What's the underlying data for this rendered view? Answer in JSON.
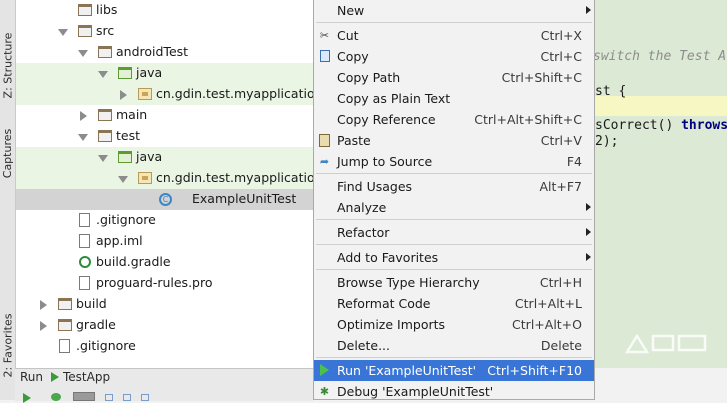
{
  "left_strip": {
    "structure_tab": "Z: Structure",
    "captures_tab": "Captures",
    "favorites_tab": "2: Favorites"
  },
  "tree": {
    "items": [
      {
        "label": "libs"
      },
      {
        "label": "src"
      },
      {
        "label": "androidTest"
      },
      {
        "label": "java"
      },
      {
        "label": "cn.gdin.test.myapplication"
      },
      {
        "label": "main"
      },
      {
        "label": "test"
      },
      {
        "label": "java"
      },
      {
        "label": "cn.gdin.test.myapplication"
      },
      {
        "label": "ExampleUnitTest"
      },
      {
        "label": ".gitignore"
      },
      {
        "label": "app.iml"
      },
      {
        "label": "build.gradle"
      },
      {
        "label": "proguard-rules.pro"
      },
      {
        "label": "build"
      },
      {
        "label": "gradle"
      },
      {
        "label": ".gitignore"
      }
    ]
  },
  "code": {
    "comment": "switch the Test A",
    "line1": "st {",
    "line2a": "sCorrect() ",
    "line2b": "throws",
    "line3": "2);"
  },
  "menu": {
    "items": [
      {
        "label": "New",
        "shortcut": ""
      },
      {
        "label": "Cut",
        "shortcut": "Ctrl+X"
      },
      {
        "label": "Copy",
        "shortcut": "Ctrl+C"
      },
      {
        "label": "Copy Path",
        "shortcut": "Ctrl+Shift+C"
      },
      {
        "label": "Copy as Plain Text",
        "shortcut": ""
      },
      {
        "label": "Copy Reference",
        "shortcut": "Ctrl+Alt+Shift+C"
      },
      {
        "label": "Paste",
        "shortcut": "Ctrl+V"
      },
      {
        "label": "Jump to Source",
        "shortcut": "F4"
      },
      {
        "label": "Find Usages",
        "shortcut": "Alt+F7"
      },
      {
        "label": "Analyze",
        "shortcut": ""
      },
      {
        "label": "Refactor",
        "shortcut": ""
      },
      {
        "label": "Add to Favorites",
        "shortcut": ""
      },
      {
        "label": "Browse Type Hierarchy",
        "shortcut": "Ctrl+H"
      },
      {
        "label": "Reformat Code",
        "shortcut": "Ctrl+Alt+L"
      },
      {
        "label": "Optimize Imports",
        "shortcut": "Ctrl+Alt+O"
      },
      {
        "label": "Delete...",
        "shortcut": "Delete"
      },
      {
        "label": "Run 'ExampleUnitTest'",
        "shortcut": "Ctrl+Shift+F10"
      },
      {
        "label": "Debug 'ExampleUnitTest'",
        "shortcut": ""
      }
    ]
  },
  "bottom": {
    "run_label": "Run",
    "config_label": "TestApp"
  },
  "colors": {
    "selection": "#3875d7",
    "source_highlight": "#eaf5e4",
    "editor_bg": "#dce9d5"
  }
}
